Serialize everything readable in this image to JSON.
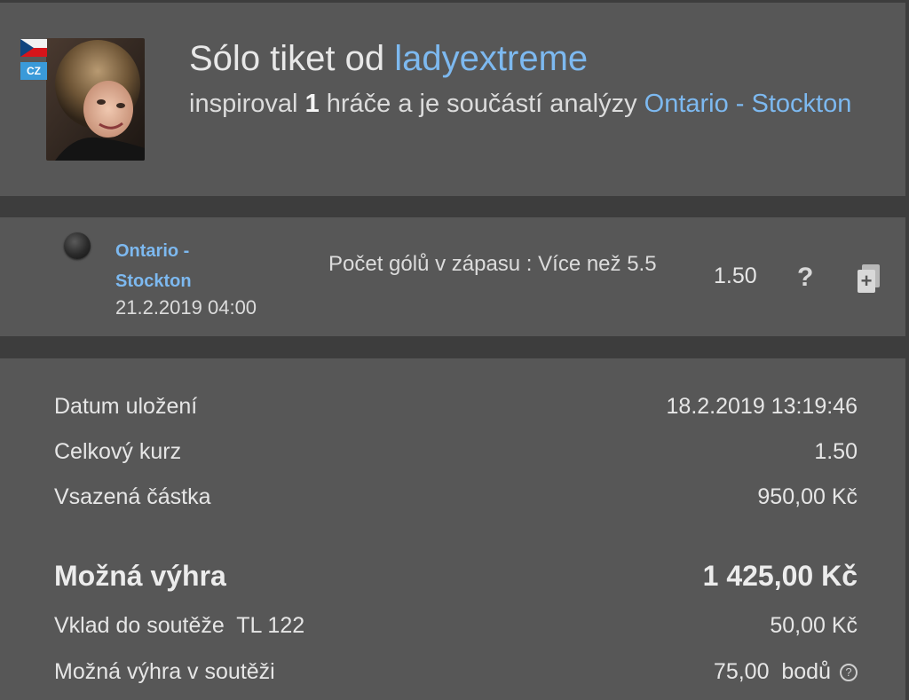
{
  "header": {
    "title_prefix": "Sólo tiket od",
    "username": "ladyextreme",
    "subtitle_prefix": "inspiroval",
    "inspired_count": "1",
    "subtitle_middle": "hráče a je součástí analýzy",
    "analysis_link": "Ontario - Stockton",
    "country_badge": "CZ",
    "avatar_icon": "user-avatar-photo"
  },
  "match": {
    "teams": "Ontario - Stockton",
    "date": "21.2.2019 04:00",
    "bet": "Počet gólů v zápasu : Více než 5.5",
    "odds": "1.50",
    "help_label": "?",
    "copy_label": "+",
    "status_icon": "black-circle-icon"
  },
  "details": {
    "rows": [
      {
        "label": "Datum uložení",
        "value": "18.2.2019 13:19:46"
      },
      {
        "label": "Celkový kurz",
        "value": "1.50"
      },
      {
        "label": "Vsazená částka",
        "value": "950,00 Kč"
      }
    ],
    "win_label": "Možná výhra",
    "win_value": "1 425,00 Kč",
    "deposit_label": "Vklad do soutěže  TL 122",
    "deposit_value": "50,00 Kč",
    "contest_label": "Možná výhra v soutěži",
    "contest_value": "75,00  bodů",
    "info_label": "?"
  },
  "colors": {
    "link": "#7db9f0",
    "panel": "#575757",
    "background": "#3d3d3d"
  }
}
